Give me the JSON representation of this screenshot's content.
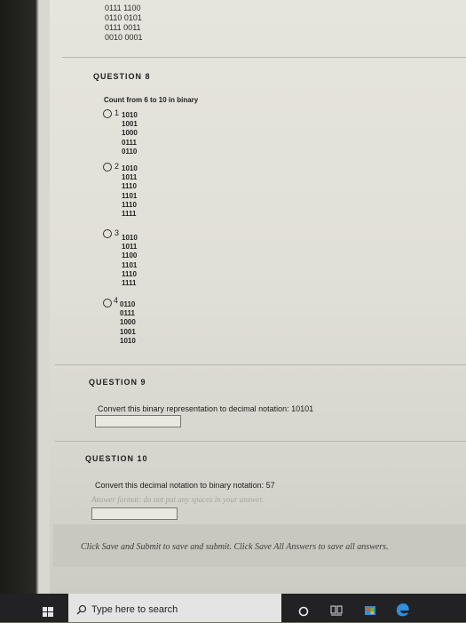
{
  "previous_question": {
    "lines": [
      "0111 1100",
      "0110 0101",
      "0111 0011",
      "0010 0001"
    ]
  },
  "question8": {
    "heading": "QUESTION 8",
    "prompt": "Count from 6 to 10 in binary",
    "options": [
      {
        "num": "1",
        "lines": [
          "1010",
          "1001",
          "1000",
          "0111",
          "0110"
        ]
      },
      {
        "num": "2",
        "lines": [
          "1010",
          "1011",
          "1110",
          "1101",
          "1110",
          "1111"
        ]
      },
      {
        "num": "3",
        "lines": [
          "1010",
          "1011",
          "1100",
          "1101",
          "1110",
          "1111"
        ]
      },
      {
        "num": "4",
        "lines": [
          "0110",
          "0111",
          "1000",
          "1001",
          "1010"
        ]
      }
    ]
  },
  "question9": {
    "heading": "QUESTION 9",
    "prompt": "Convert this binary representation to decimal notation: 10101",
    "answer": ""
  },
  "question10": {
    "heading": "QUESTION 10",
    "prompt": "Convert this decimal notation to binary notation: 57",
    "hint": "Answer format: do not put any spaces in your answer.",
    "answer": ""
  },
  "footer": {
    "text": "Click Save and Submit to save and submit. Click Save All Answers to save all answers."
  },
  "taskbar": {
    "search_placeholder": "Type here to search",
    "icons": [
      "windows-start-icon",
      "search-icon",
      "cortana-icon",
      "task-view-icon",
      "store-icon",
      "edge-icon"
    ]
  }
}
